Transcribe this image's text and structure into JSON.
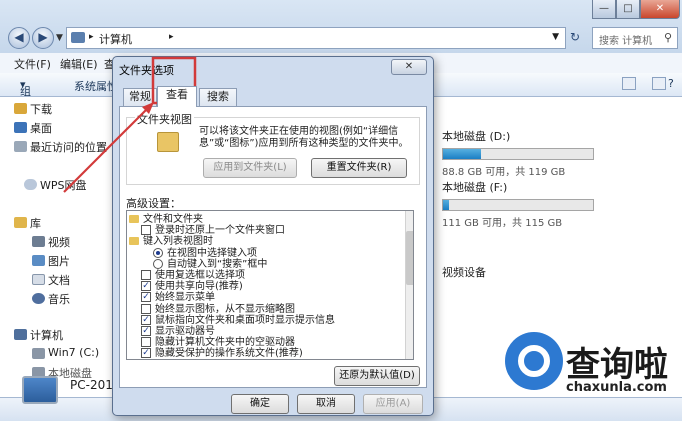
{
  "explorer": {
    "breadcrumb": "计算机",
    "search_placeholder": "搜索 计算机",
    "menu": [
      "文件(F)",
      "编辑(E)",
      "查"
    ],
    "toolbar": [
      "组织",
      "系统属性"
    ],
    "nav": {
      "favorites": [
        "下载",
        "桌面",
        "最近访问的位置"
      ],
      "wps": "WPS网盘",
      "library": "库",
      "library_items": [
        "视频",
        "图片",
        "文档",
        "音乐"
      ],
      "computer": "计算机",
      "drives": [
        "Win7 (C:)",
        "本地磁盘"
      ]
    },
    "disks": [
      {
        "name": "本地磁盘 (D:)",
        "info": "88.8 GB 可用，共 119 GB",
        "used_fraction": 0.25
      },
      {
        "name": "本地磁盘 (F:)",
        "info": "111 GB 可用，共 115 GB",
        "used_fraction": 0.04
      }
    ],
    "other_label": "视频设备",
    "status_pc": "PC-2017"
  },
  "dialog": {
    "title": "文件夹选项",
    "close": "✕",
    "tabs": [
      "常规",
      "查看",
      "搜索"
    ],
    "active_tab": 1,
    "folder_view": {
      "legend": "文件夹视图",
      "description": "可以将该文件夹正在使用的视图(例如“详细信息”或“图标”)应用到所有这种类型的文件夹中。",
      "apply_button": "应用到文件夹(L)",
      "reset_button": "重置文件夹(R)"
    },
    "advanced_label": "高级设置：",
    "advanced_items": [
      {
        "kind": "folder",
        "label": "文件和文件夹"
      },
      {
        "kind": "check",
        "checked": false,
        "label": "登录时还原上一个文件夹窗口"
      },
      {
        "kind": "folder",
        "label": "键入列表视图时"
      },
      {
        "kind": "radio",
        "checked": true,
        "label": "在视图中选择键入项"
      },
      {
        "kind": "radio",
        "checked": false,
        "label": "自动键入到“搜索”框中"
      },
      {
        "kind": "check",
        "checked": false,
        "label": "使用复选框以选择项"
      },
      {
        "kind": "check",
        "checked": true,
        "label": "使用共享向导(推荐)"
      },
      {
        "kind": "check",
        "checked": true,
        "label": "始终显示菜单"
      },
      {
        "kind": "check",
        "checked": false,
        "label": "始终显示图标，从不显示缩略图"
      },
      {
        "kind": "check",
        "checked": true,
        "label": "鼠标指向文件夹和桌面项时显示提示信息"
      },
      {
        "kind": "check",
        "checked": true,
        "label": "显示驱动器号"
      },
      {
        "kind": "check",
        "checked": false,
        "label": "隐藏计算机文件夹中的空驱动器"
      },
      {
        "kind": "check",
        "checked": true,
        "label": "隐藏受保护的操作系统文件(推荐)"
      }
    ],
    "restore_button": "还原为默认值(D)",
    "ok_button": "确定",
    "cancel_button": "取消",
    "apply_button": "应用(A)"
  },
  "watermark": {
    "text": "查询啦",
    "url": "chaxunla.com"
  },
  "colors": {
    "annotation": "#d23a3a",
    "disk_fill": "#1b7fc4",
    "watermark_blue": "#2d79d1"
  }
}
